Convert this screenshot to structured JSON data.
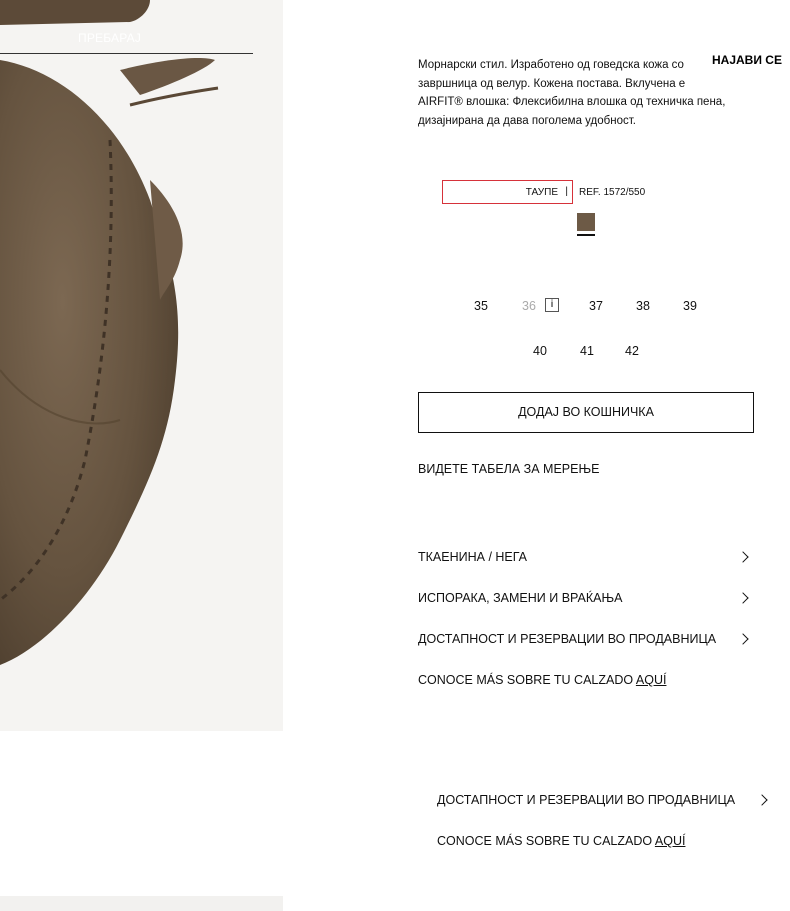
{
  "header": {
    "search_label": "ПРЕБАРАЈ",
    "login_label": "НАЈАВИ СЕ"
  },
  "product": {
    "description": "Морнарски стил. Изработено од говедска кожа со завршница од велур. Кожена постава. Вклучена е AIRFIT® влошка: Флексибилна влошка од техничка пена, дизајнирана да дава поголема удобност.",
    "color": {
      "name": "ТАУПЕ",
      "separator": "|",
      "ref": "REF. 1572/550",
      "swatch_color": "#6d5a46"
    },
    "sizes_row1": [
      {
        "label": "35",
        "available": true
      },
      {
        "label": "36",
        "available": false
      },
      {
        "label": "37",
        "available": true
      },
      {
        "label": "38",
        "available": true
      },
      {
        "label": "39",
        "available": true
      }
    ],
    "sizes_row2": [
      {
        "label": "40",
        "available": true
      },
      {
        "label": "41",
        "available": true
      },
      {
        "label": "42",
        "available": true
      }
    ],
    "size_info_icon": "info-icon",
    "add_to_cart_label": "ДОДАЈ ВО КОШНИЧКА",
    "size_guide_label": "ВИДЕТЕ ТАБЕЛА ЗА МЕРЕЊЕ"
  },
  "accordion": [
    {
      "label": "ТКАЕНИНА / НЕГА"
    },
    {
      "label": "ИСПОРАКА, ЗАМЕНИ И ВРАЌАЊА"
    },
    {
      "label": "ДОСТАПНОСТ И РЕЗЕРВАЦИИ ВО ПРОДАВНИЦА"
    }
  ],
  "footwear_link": {
    "text": "CONOCE MÁS SOBRE TU CALZADO",
    "link": "AQUÍ"
  },
  "sticky": {
    "availability_label": "ДОСТАПНОСТ И РЕЗЕРВАЦИИ ВО ПРОДАВНИЦА",
    "footwear_text": "CONOCE MÁS SOBRE TU CALZADO",
    "footwear_link": "AQUÍ"
  },
  "colors": {
    "accent_border": "#d6323a",
    "suede": "#6d5a46"
  }
}
